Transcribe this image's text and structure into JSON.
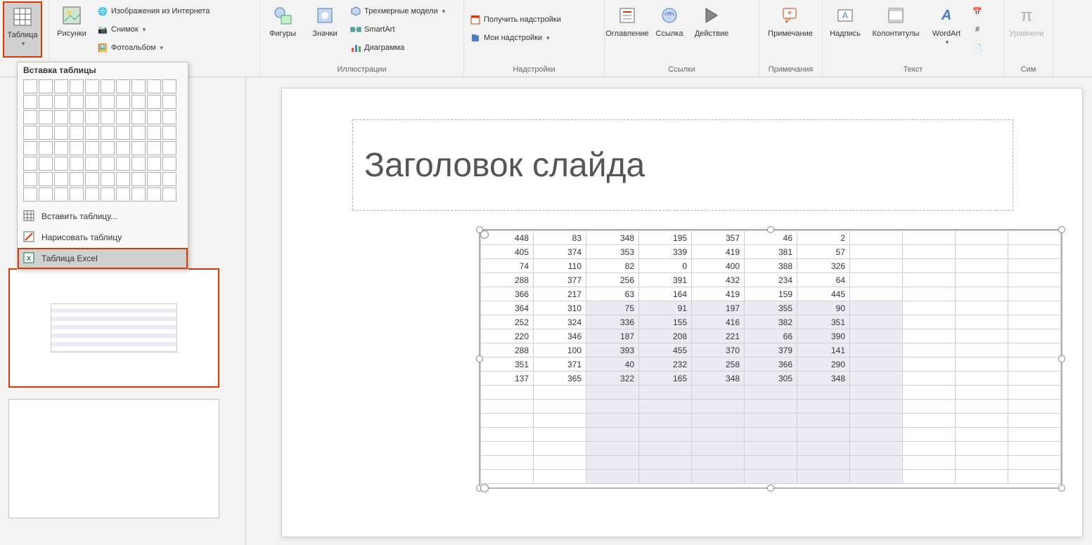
{
  "ribbon": {
    "table": {
      "label": "Таблица"
    },
    "pictures": {
      "label": "Рисунки"
    },
    "online_pics": "Изображения из Интернета",
    "screenshot": "Снимок",
    "photo_album": "Фотоальбом",
    "shapes": "Фигуры",
    "icons": "Значки",
    "3d_models": "Трехмерные модели",
    "smartart": "SmartArt",
    "chart": "Диаграмма",
    "get_addins": "Получить надстройки",
    "my_addins": "Мои надстройки",
    "toc": "Оглавление",
    "link": "Ссылка",
    "action": "Действие",
    "comment": "Примечание",
    "textbox": "Надпись",
    "header_footer": "Колонтитулы",
    "wordart": "WordArt",
    "equation": "Уравнени",
    "group_illustrations": "Иллюстрации",
    "group_addins": "Надстройки",
    "group_links": "Ссылки",
    "group_comments": "Примечания",
    "group_text": "Текст",
    "group_sym": "Сим"
  },
  "dropdown": {
    "header": "Вставка таблицы",
    "insert_table": "Вставить таблицу...",
    "draw_table": "Нарисовать таблицу",
    "excel_table": "Таблица Excel"
  },
  "slide": {
    "title": "Заголовок слайда"
  },
  "table_data": {
    "rows": [
      [
        448,
        83,
        348,
        195,
        357,
        46,
        2
      ],
      [
        405,
        374,
        353,
        339,
        419,
        381,
        57
      ],
      [
        74,
        110,
        82,
        0,
        400,
        388,
        326
      ],
      [
        288,
        377,
        256,
        391,
        432,
        234,
        64
      ],
      [
        366,
        217,
        63,
        164,
        419,
        159,
        445
      ],
      [
        364,
        310,
        75,
        91,
        197,
        355,
        90
      ],
      [
        252,
        324,
        336,
        155,
        416,
        382,
        351
      ],
      [
        220,
        346,
        187,
        208,
        221,
        66,
        390
      ],
      [
        288,
        100,
        393,
        455,
        370,
        379,
        141
      ],
      [
        351,
        371,
        40,
        232,
        258,
        366,
        290
      ],
      [
        137,
        365,
        322,
        165,
        348,
        305,
        348
      ]
    ],
    "total_cols": 11,
    "total_rows": 18,
    "alt_col_start": 2,
    "alt_col_end": 7,
    "alt_row_start": 5
  }
}
